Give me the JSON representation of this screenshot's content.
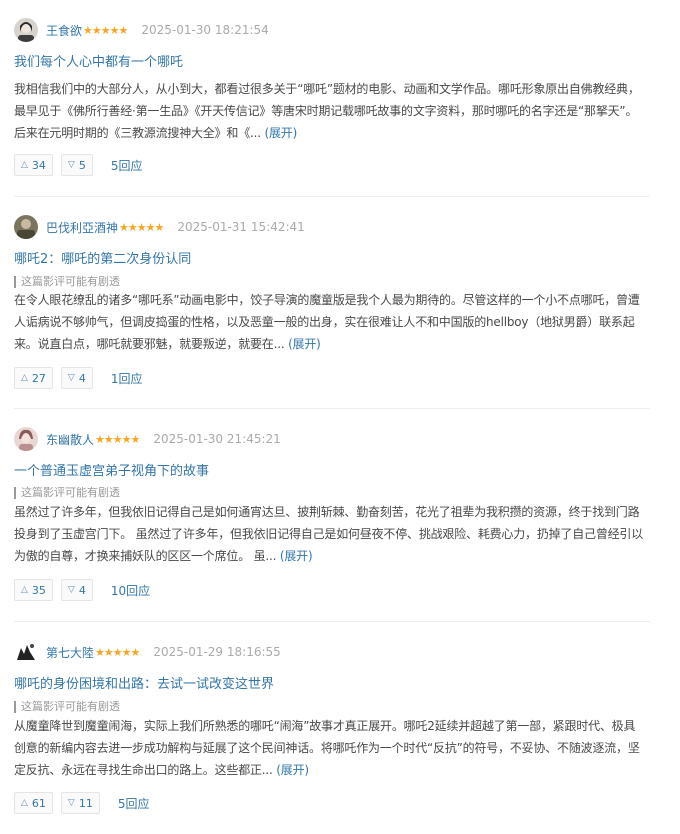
{
  "reviews": [
    {
      "author": "王食欲",
      "stars": "★★★★★",
      "time": "2025-01-30 18:21:54",
      "title": "我们每个人心中都有一个哪吒",
      "warning": "",
      "body": "我相信我们中的大部分人，从小到大，都看过很多关于“哪吒”题材的电影、动画和文学作品。哪吒形象原出自佛教经典，最早见于《佛所行善经·第一生品》《开天传信记》等唐宋时期记载哪吒故事的文字资料，那时哪吒的名字还是“那拏天”。后来在元明时期的《三教源流搜神大全》和《...",
      "expand": "(展开)",
      "up": "34",
      "down": "5",
      "replies": "5回应",
      "avatar_color": "#c9c4bd"
    },
    {
      "author": "巴伐利亞酒神",
      "stars": "★★★★★",
      "time": "2025-01-31 15:42:41",
      "title": "哪吒2：哪吒的第二次身份认同",
      "warning": "这篇影评可能有剧透",
      "body": "在令人眼花缭乱的诸多“哪吒系”动画电影中，饺子导演的魔童版是我个人最为期待的。尽管这样的一个小不点哪吒，曾遭人诟病说不够帅气，但调皮捣蛋的性格，以及恶童一般的出身，实在很难让人不和中国版的hellboy（地狱男爵）联系起来。说直白点，哪吒就要邪魅，就要叛逆，就要在...",
      "expand": "(展开)",
      "up": "27",
      "down": "4",
      "replies": "1回应",
      "avatar_color": "#6f6a58"
    },
    {
      "author": "东幽散人",
      "stars": "★★★★★",
      "time": "2025-01-30 21:45:21",
      "title": "一个普通玉虚宫弟子视角下的故事",
      "warning": "这篇影评可能有剧透",
      "body": "虽然过了许多年，但我依旧记得自己是如何通宵达旦、披荆斩棘、勤奋刻苦，花光了祖辈为我积攒的资源，终于找到门路投身到了玉虚宫门下。 虽然过了许多年，但我依旧记得自己是如何昼夜不停、挑战艰险、耗费心力，扔掉了自己曾经引以为傲的自尊，才换来捕妖队的区区一个席位。 虽...",
      "expand": "(展开)",
      "up": "35",
      "down": "4",
      "replies": "10回应",
      "avatar_color": "#d9b7b0"
    },
    {
      "author": "第七大陸",
      "stars": "★★★★★",
      "time": "2025-01-29 18:16:55",
      "title": "哪吒的身份困境和出路：去试一试改变这世界",
      "warning": "这篇影评可能有剧透",
      "body": "从魔童降世到魔童闹海，实际上我们所熟悉的哪吒“闹海”故事才真正展开。哪吒2延续并超越了第一部，紧跟时代、极具创意的新编内容去进一步成功解构与延展了这个民间神话。将哪吒作为一个时代“反抗”的符号，不妥协、不随波逐流，坚定反抗、永远在寻找生命出口的路上。这些都正...",
      "expand": "(展开)",
      "up": "61",
      "down": "11",
      "replies": "5回应",
      "avatar_color": "#3a3a3a"
    }
  ]
}
